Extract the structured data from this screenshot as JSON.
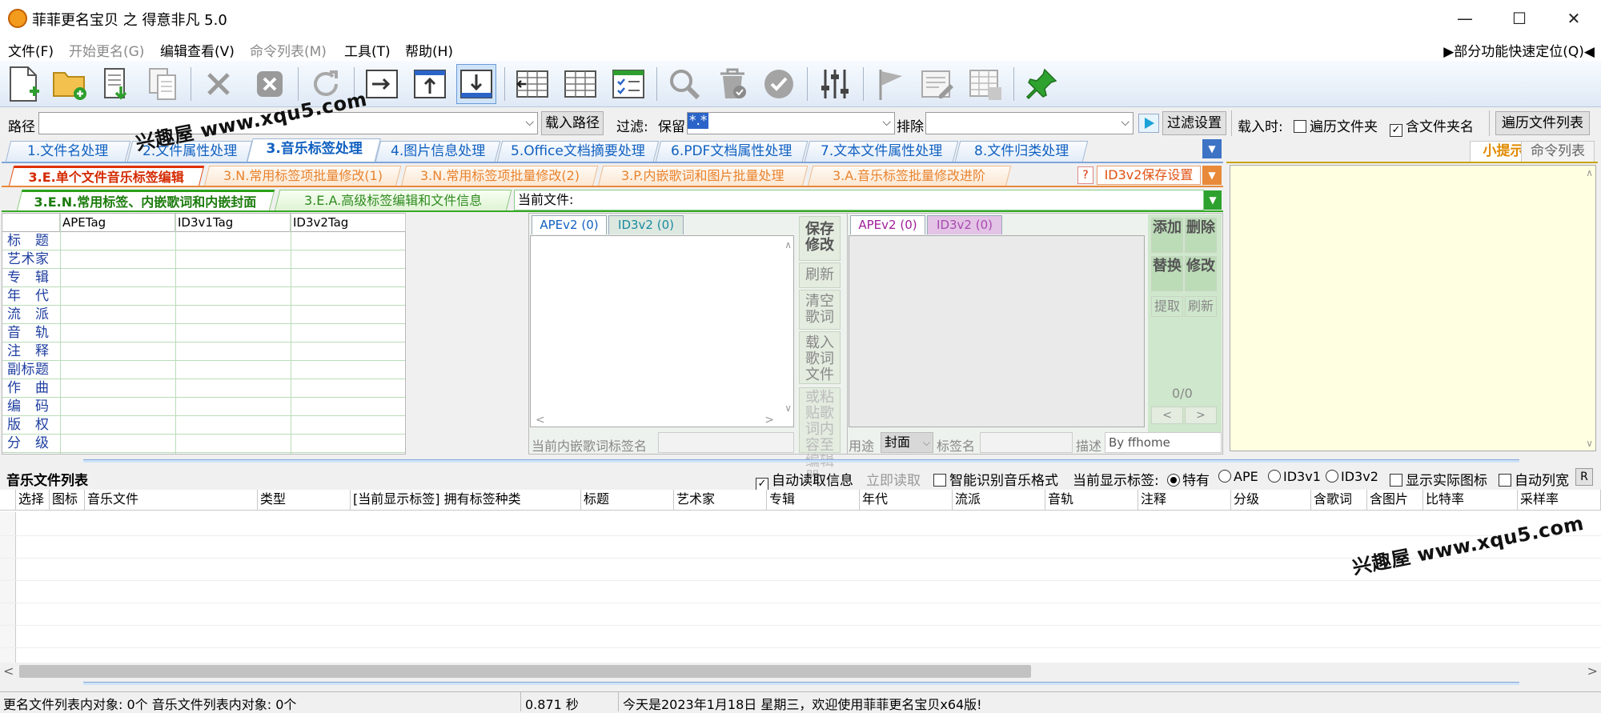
{
  "window": {
    "title": "菲菲更名宝贝 之 得意非凡 5.0",
    "min": "—",
    "max": "☐",
    "close": "✕"
  },
  "menu": {
    "items": [
      "文件(F)",
      "开始更名(G)",
      "编辑查看(V)",
      "命令列表(M)",
      "工具(T)",
      "帮助(H)"
    ],
    "quick_locate": "▶部分功能快速定位(Q)◀"
  },
  "toolbar": {
    "icons": [
      "new-file-icon",
      "open-folder-icon",
      "import-icon",
      "copy-doc-icon",
      "delete-icon",
      "close-box-icon",
      "refresh-icon",
      "move-right-icon",
      "move-top-icon",
      "move-bottom-icon",
      "columns-left-icon",
      "columns-icon",
      "checklist-icon",
      "search-doc-icon",
      "trash-icon",
      "confirm-icon",
      "sliders-icon",
      "flag-icon",
      "edit-doc-icon",
      "table-icon",
      "pin-icon"
    ]
  },
  "pathbar": {
    "path_label": "路径",
    "path_value": "",
    "load_path": "载入路径",
    "filter_label": "过滤:",
    "keep_label": "保留",
    "keep_value": "*.*",
    "exclude_label": "排除",
    "exclude_value": "",
    "filter_settings": "过滤设置",
    "load_time_label": "载入时:",
    "traverse_folders": "遍历文件夹",
    "include_folder_names": "含文件夹名",
    "traverse_list": "遍历文件列表"
  },
  "main_tabs": [
    "1.文件名处理",
    "2.文件属性处理",
    "3.音乐标签处理",
    "4.图片信息处理",
    "5.Office文档摘要处理",
    "6.PDF文档属性处理",
    "7.文本文件属性处理",
    "8.文件归类处理"
  ],
  "sub_tabs": [
    "3.E.单个文件音乐标签编辑",
    "3.N.常用标签项批量修改(1)",
    "3.N.常用标签项批量修改(2)",
    "3.P.内嵌歌词和图片批量处理",
    "3.A.音乐标签批量修改进阶"
  ],
  "id3_save": "ID3v2保存设置",
  "help_q": "?",
  "sub_sub_tabs": [
    "3.E.N.常用标签、内嵌歌词和内嵌封面",
    "3.E.A.高级标签编辑和文件信息"
  ],
  "current_file_label": "当前文件:",
  "current_file_value": "",
  "tag_grid": {
    "headers": [
      "APETag",
      "ID3v1Tag",
      "ID3v2Tag"
    ],
    "rows": [
      "标题",
      "艺术家",
      "专辑",
      "年代",
      "流派",
      "音轨",
      "注释",
      "副标题",
      "作曲",
      "编码",
      "版权",
      "分级"
    ]
  },
  "lyrics_panel": {
    "tab_ape": "APEv2 (0)",
    "tab_id3": "ID3v2 (0)",
    "save_btn": "保存修改",
    "refresh_btn": "刷新",
    "clear_btn": "清空歌词",
    "load_btn": "载入歌词文件",
    "paste_btn": "或粘贴歌词内容至编辑器。",
    "tag_name_label": "当前内嵌歌词标签名"
  },
  "picture_panel": {
    "tab_ape": "APEv2 (0)",
    "tab_id3": "ID3v2 (0)",
    "add_btn": "添加",
    "delete_btn": "删除",
    "replace_btn": "替换",
    "modify_btn": "修改",
    "extract_btn": "提取",
    "refresh_btn": "刷新",
    "counter": "0/0",
    "prev": "<",
    "next": ">",
    "usage_label": "用途",
    "usage_value": "封面",
    "tag_name_label": "标签名",
    "desc_label": "描述",
    "desc_value": "By ffhome"
  },
  "tips": {
    "tab_tips": "小提示",
    "tab_cmd": "命令列表"
  },
  "music_list": {
    "title": "音乐文件列表",
    "auto_read": "自动读取信息",
    "read_now": "立即读取",
    "smart_detect": "智能识别音乐格式",
    "current_tags_label": "当前显示标签:",
    "radio_options": [
      "特有",
      "APE",
      "ID3v1",
      "ID3v2"
    ],
    "show_icons": "显示实际图标",
    "auto_width": "自动列宽",
    "r_btn": "R",
    "columns": [
      "选择",
      "图标",
      "音乐文件",
      "类型",
      "[当前显示标签] 拥有标签种类",
      "标题",
      "艺术家",
      "专辑",
      "年代",
      "流派",
      "音轨",
      "注释",
      "分级",
      "含歌词",
      "含图片",
      "比特率",
      "采样率"
    ]
  },
  "watermarks": [
    "兴趣屋 www.xqu5.com",
    "兴趣屋 www.xqu5.com"
  ],
  "status": {
    "left": "更名文件列表内对象: 0个  音乐文件列表内对象: 0个",
    "time": "0.871 秒",
    "message": "今天是2023年1月18日 星期三，欢迎使用菲菲更名宝贝x64版!"
  }
}
